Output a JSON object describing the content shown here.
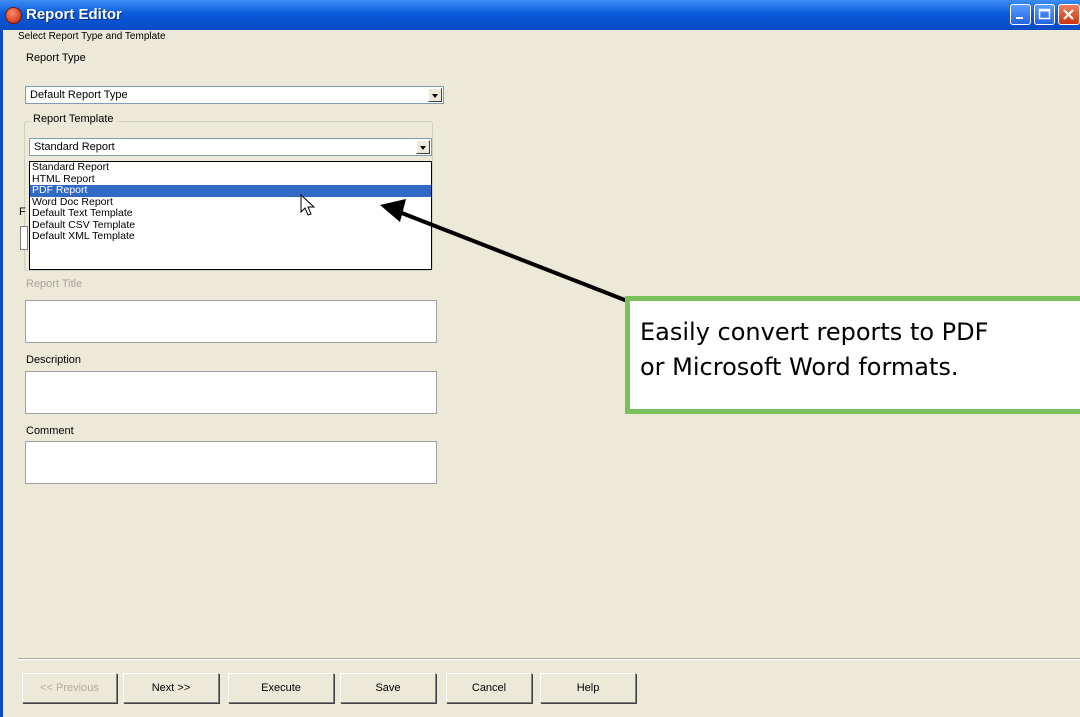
{
  "window": {
    "title": "Report Editor"
  },
  "form": {
    "section_label": "Select Report Type and Template",
    "report_type_label": "Report Type",
    "report_type_value": "Default Report Type",
    "template_group_label": "Report Template",
    "template_value": "Standard Report",
    "template_options": [
      "Standard Report",
      "HTML Report",
      "PDF Report",
      "Word Doc Report",
      "Default Text Template",
      "Default CSV Template",
      "Default XML Template"
    ],
    "highlighted_option": "PDF Report",
    "report_title_label": "Report Title",
    "description_label": "Description",
    "comment_label": "Comment"
  },
  "buttons": {
    "previous": "<< Previous",
    "next": "Next >>",
    "execute": "Execute",
    "save": "Save",
    "cancel": "Cancel",
    "help": "Help"
  },
  "callout": {
    "line1": "Easily convert reports to PDF",
    "line2": "or Microsoft Word formats."
  },
  "colors": {
    "titlebar": "#0a5ad9",
    "selection": "#316ac5",
    "callout_border": "#79c15a"
  }
}
